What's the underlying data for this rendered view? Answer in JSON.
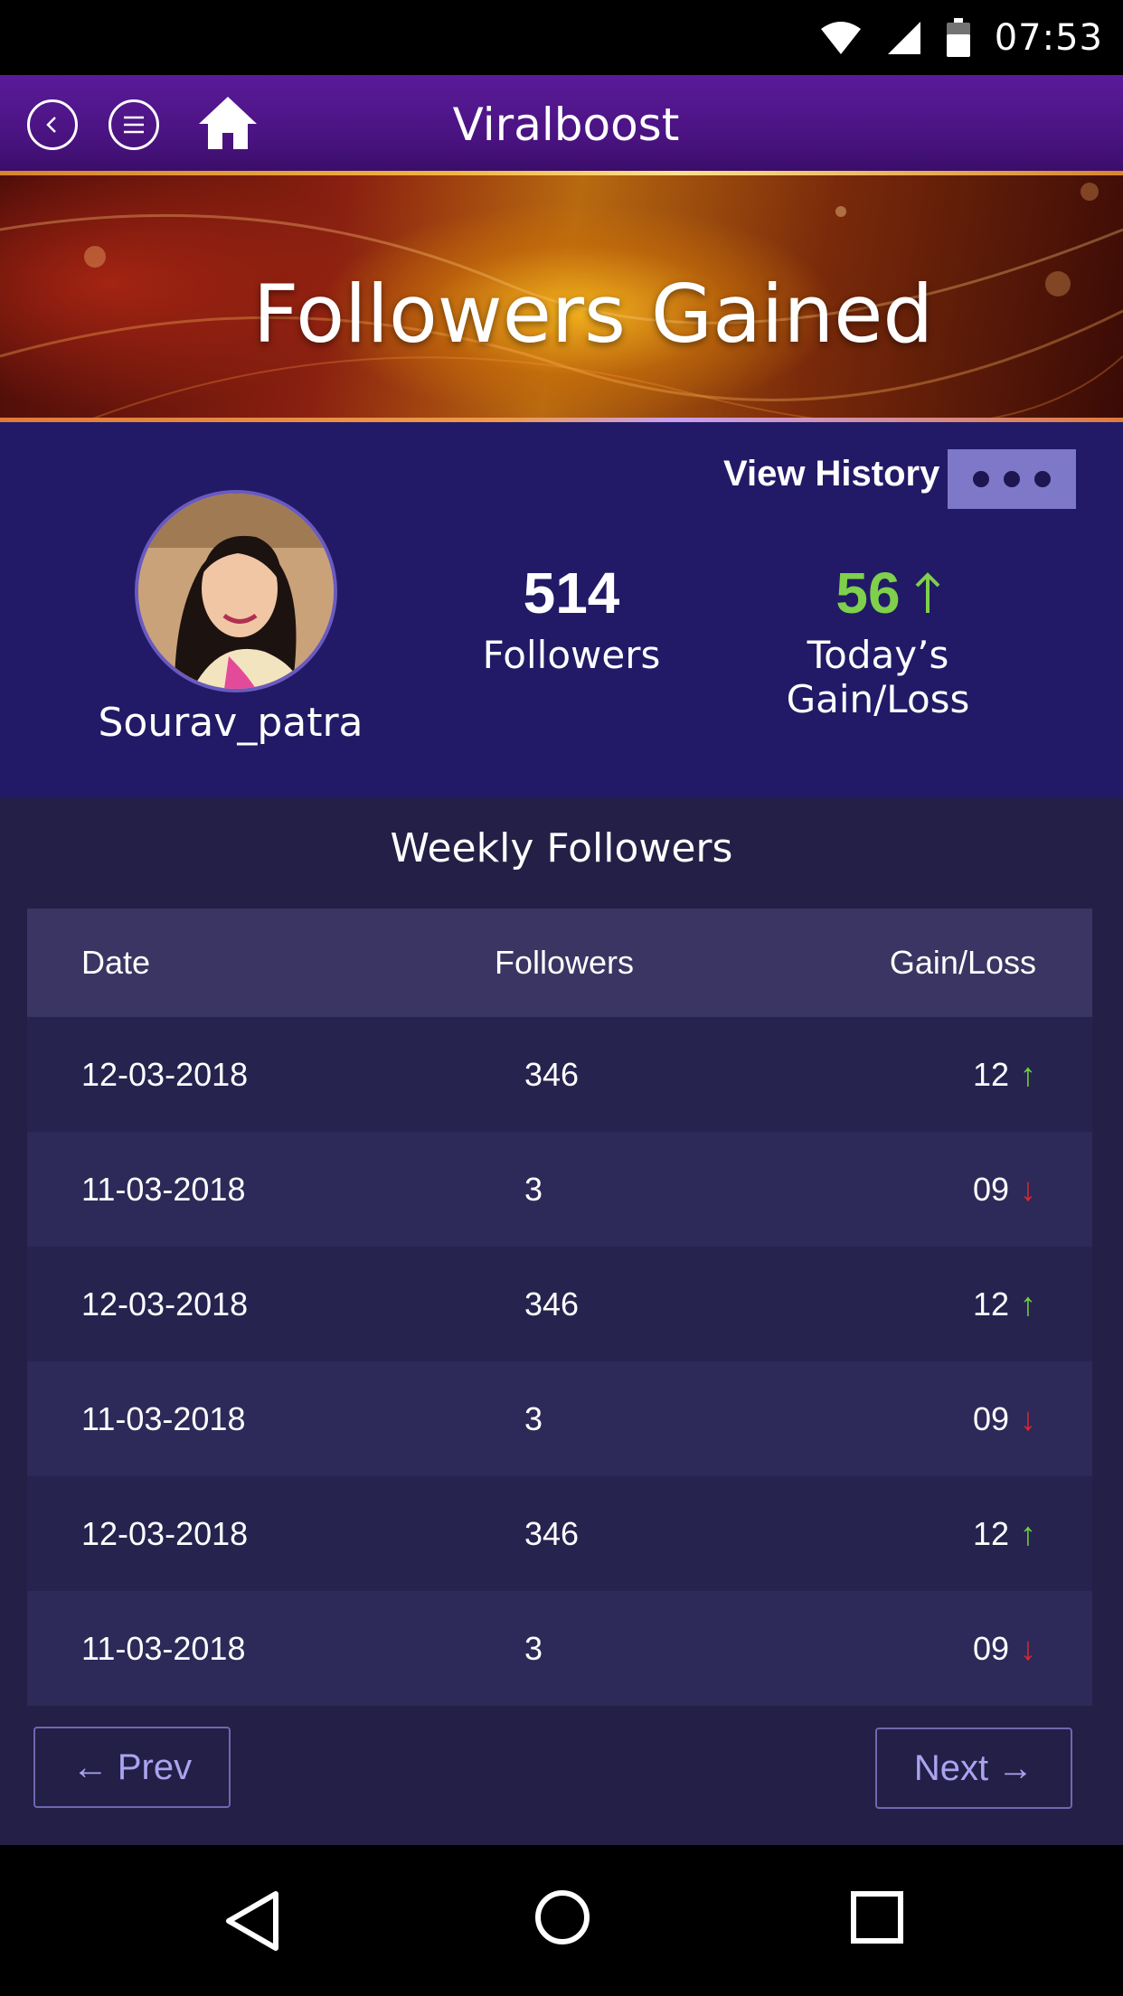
{
  "status_bar": {
    "time": "07:53",
    "icons": [
      "wifi-icon",
      "signal-icon",
      "battery-icon"
    ]
  },
  "header": {
    "title": "Viralboost",
    "icons": [
      "back-icon",
      "menu-icon",
      "home-icon"
    ]
  },
  "banner": {
    "title": "Followers Gained"
  },
  "profile": {
    "view_history_label": "View History",
    "username": "Sourav_patra",
    "followers_count": "514",
    "followers_label": "Followers",
    "today_gain": "56",
    "today_gain_label": "Today’s Gain/Loss"
  },
  "weekly": {
    "title": "Weekly Followers",
    "columns": [
      "Date",
      "Followers",
      "Gain/Loss"
    ],
    "rows": [
      {
        "date": "12-03-2018",
        "followers": "346",
        "gain": "12",
        "direction": "up"
      },
      {
        "date": "11-03-2018",
        "followers": "3",
        "gain": "09",
        "direction": "down"
      },
      {
        "date": "12-03-2018",
        "followers": "346",
        "gain": "12",
        "direction": "up"
      },
      {
        "date": "11-03-2018",
        "followers": "3",
        "gain": "09",
        "direction": "down"
      },
      {
        "date": "12-03-2018",
        "followers": "346",
        "gain": "12",
        "direction": "up"
      },
      {
        "date": "11-03-2018",
        "followers": "3",
        "gain": "09",
        "direction": "down"
      }
    ]
  },
  "pagination": {
    "prev_label": "Prev",
    "next_label": "Next"
  },
  "colors": {
    "gain_green": "#7fd04a",
    "loss_red": "#e0252a",
    "profile_bg": "#221a66",
    "table_bg": "#231f46"
  }
}
